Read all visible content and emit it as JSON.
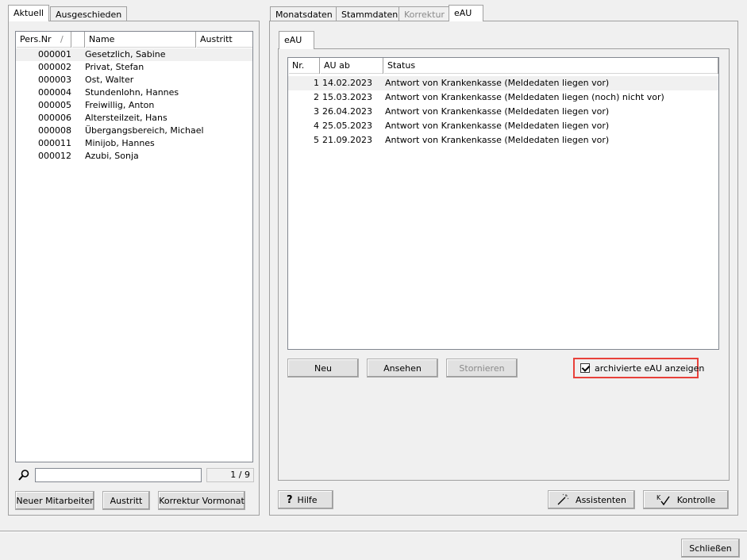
{
  "left_tabs": [
    {
      "label": "Aktuell"
    },
    {
      "label": "Ausgeschieden"
    }
  ],
  "employee_list": {
    "columns": {
      "pers_nr": "Pers.Nr",
      "sort_indicator": "/",
      "name": "Name",
      "austritt": "Austritt"
    },
    "rows": [
      {
        "pers_nr": "000001",
        "name": "Gesetzlich, Sabine"
      },
      {
        "pers_nr": "000002",
        "name": "Privat, Stefan"
      },
      {
        "pers_nr": "000003",
        "name": "Ost, Walter"
      },
      {
        "pers_nr": "000004",
        "name": "Stundenlohn, Hannes"
      },
      {
        "pers_nr": "000005",
        "name": "Freiwillig, Anton"
      },
      {
        "pers_nr": "000006",
        "name": "Altersteilzeit, Hans"
      },
      {
        "pers_nr": "000008",
        "name": "Übergangsbereich, Michael"
      },
      {
        "pers_nr": "000011",
        "name": "Minijob, Hannes"
      },
      {
        "pers_nr": "000012",
        "name": "Azubi, Sonja"
      }
    ]
  },
  "search": {
    "value": "",
    "counter": "1 / 9"
  },
  "left_buttons": {
    "new_employee": "Neuer Mitarbeiter",
    "exit": "Austritt",
    "correction": "Korrektur Vormonat"
  },
  "right_tabs": [
    {
      "label": "Monatsdaten"
    },
    {
      "label": "Stammdaten"
    },
    {
      "label": "Korrektur"
    },
    {
      "label": "eAU"
    }
  ],
  "inner_tab": {
    "label": "eAU"
  },
  "eau_list": {
    "columns": {
      "nr": "Nr.",
      "au_ab": "AU ab",
      "status": "Status"
    },
    "rows": [
      {
        "nr": "1",
        "au_ab": "14.02.2023",
        "status": "Antwort von Krankenkasse (Meldedaten liegen vor)"
      },
      {
        "nr": "2",
        "au_ab": "15.03.2023",
        "status": "Antwort von Krankenkasse (Meldedaten liegen (noch) nicht vor)"
      },
      {
        "nr": "3",
        "au_ab": "26.04.2023",
        "status": "Antwort von Krankenkasse (Meldedaten liegen vor)"
      },
      {
        "nr": "4",
        "au_ab": "25.05.2023",
        "status": "Antwort von Krankenkasse (Meldedaten liegen vor)"
      },
      {
        "nr": "5",
        "au_ab": "21.09.2023",
        "status": "Antwort von Krankenkasse (Meldedaten liegen vor)"
      }
    ]
  },
  "eau_buttons": {
    "new": "Neu",
    "view": "Ansehen",
    "cancel": "Stornieren"
  },
  "archive_checkbox": {
    "label": "archivierte eAU anzeigen",
    "checked": true,
    "highlight_color": "#e8413a"
  },
  "bottom_buttons": {
    "help": "Hilfe",
    "help_glyph": "?",
    "assistants": "Assistenten",
    "control": "Kontrolle"
  },
  "footer": {
    "close": "Schließen"
  }
}
